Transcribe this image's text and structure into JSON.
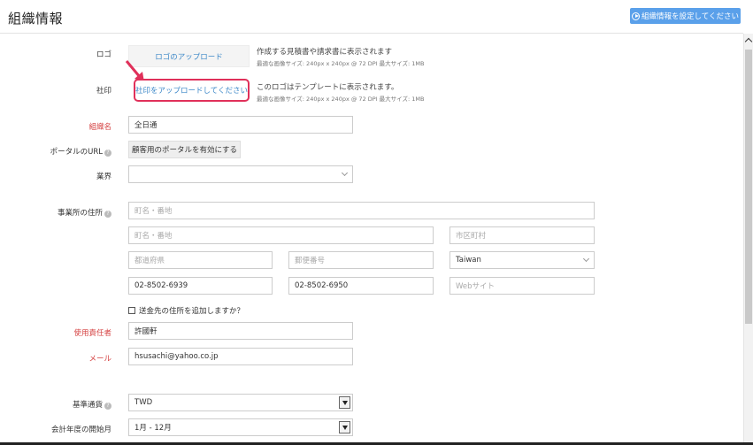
{
  "header": {
    "title": "組織情報",
    "setup_button": "組織情報を設定してください",
    "setup_icon": "play-circle-icon"
  },
  "logo": {
    "label": "ロゴ",
    "button": "ロゴのアップロード",
    "note": "作成する見積書や請求書に表示されます",
    "subnote": "最適な画像サイズ: 240px x 240px @ 72 DPI 最大サイズ: 1MB"
  },
  "seal": {
    "label": "社印",
    "button": "社印をアップロードしてください",
    "note": "このロゴはテンプレートに表示されます。",
    "subnote": "最適な画像サイズ: 240px x 240px @ 72 DPI 最大サイズ: 1MB",
    "highlight_color": "#e0305a"
  },
  "org_name": {
    "label": "組織名",
    "value": "全日通"
  },
  "portal": {
    "label": "ポータルのURL",
    "button": "顧客用のポータルを有効にする"
  },
  "industry": {
    "label": "業界",
    "value": ""
  },
  "address": {
    "label": "事業所の住所",
    "street1_placeholder": "町名・番地",
    "street2_placeholder": "町名・番地",
    "city_placeholder": "市区町村",
    "state_placeholder": "都道府県",
    "zip_placeholder": "郵便番号",
    "country": "Taiwan",
    "phone": "02-8502-6939",
    "fax": "02-8502-6950",
    "website_placeholder": "Webサイト"
  },
  "shipping_checkbox": "送金先の住所を追加しますか？",
  "contact": {
    "label": "使用責任者",
    "value": "許國軒"
  },
  "email": {
    "label": "メール",
    "value": "hsusachi@yahoo.co.jp"
  },
  "currency": {
    "label": "基準通貨",
    "value": "TWD"
  },
  "fiscal_year": {
    "label": "会計年度の開始月",
    "value": "1月 - 12月"
  },
  "colors": {
    "accent": "#5aa0ea",
    "required": "#d43f3f",
    "link": "#3d88c8"
  }
}
